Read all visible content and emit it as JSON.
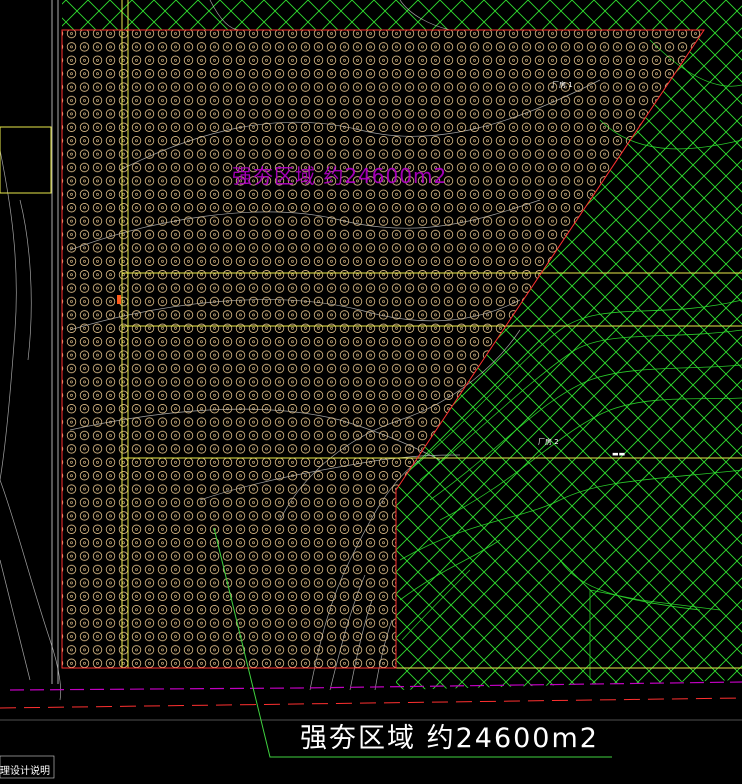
{
  "drawing": {
    "region_label": "强夯区域 约24600m2",
    "ghost_label": "强夯区域 约24600m2",
    "corner_label": "理设计说明",
    "notes": [
      "厂房 1",
      "厂房 2",
      "▬▬"
    ]
  },
  "colors": {
    "background": "#000000",
    "boundary": "#ff3030",
    "hatch": "#2fe02f",
    "grid_line": "#e8e84a",
    "pile_marker": "#e8c88a",
    "contour": "#d8d8d8",
    "magenta_line": "#c000c0",
    "leader": "#3fd23f"
  }
}
